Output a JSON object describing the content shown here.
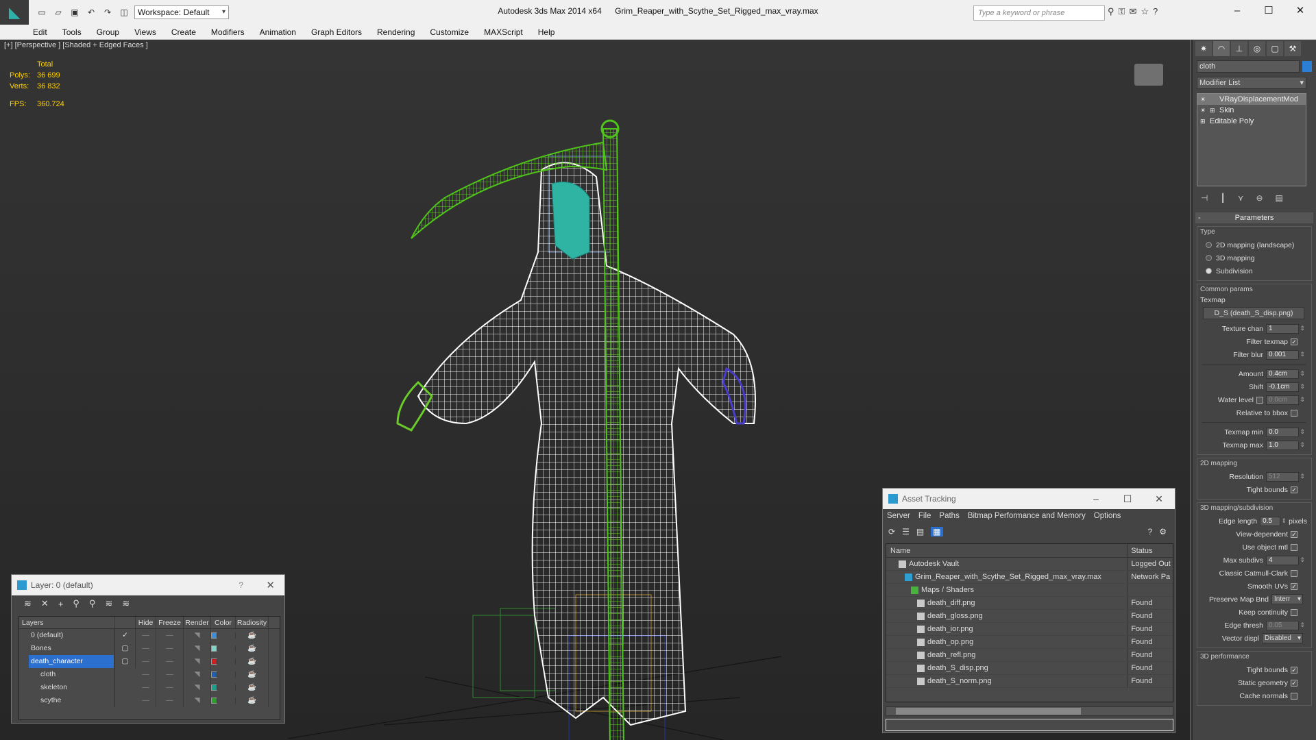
{
  "app": {
    "title": "Autodesk 3ds Max  2014 x64",
    "file": "Grim_Reaper_with_Scythe_Set_Rigged_max_vray.max",
    "workspace": "Workspace: Default",
    "search_placeholder": "Type a keyword or phrase"
  },
  "menu": [
    "Edit",
    "Tools",
    "Group",
    "Views",
    "Create",
    "Modifiers",
    "Animation",
    "Graph Editors",
    "Rendering",
    "Customize",
    "MAXScript",
    "Help"
  ],
  "viewport": {
    "label": "[+] [Perspective ] [Shaded + Edged Faces ]",
    "stats": {
      "total_label": "Total",
      "polys_label": "Polys:",
      "polys": "36 699",
      "verts_label": "Verts:",
      "verts": "36 832",
      "fps_label": "FPS:",
      "fps": "360.724"
    }
  },
  "command_panel": {
    "object_name": "cloth",
    "modifier_list": "Modifier List",
    "stack": [
      "VRayDisplacementMod",
      "Skin",
      "Editable Poly"
    ],
    "rollout": "Parameters",
    "type_group": "Type",
    "type_options": [
      "2D mapping (landscape)",
      "3D mapping",
      "Subdivision"
    ],
    "common_params": "Common params",
    "texmap_label": "Texmap",
    "texmap_value": "D_S (death_S_disp.png)",
    "texture_chan_label": "Texture chan",
    "texture_chan": "1",
    "filter_texmap_label": "Filter texmap",
    "filter_blur_label": "Filter blur",
    "filter_blur": "0.001",
    "amount_label": "Amount",
    "amount": "0.4cm",
    "shift_label": "Shift",
    "shift": "-0.1cm",
    "water_level_label": "Water level",
    "water_level": "0.0cm",
    "relative_bbox_label": "Relative to bbox",
    "texmap_min_label": "Texmap min",
    "texmap_min": "0.0",
    "texmap_max_label": "Texmap max",
    "texmap_max": "1.0",
    "mapping2d_group": "2D mapping",
    "resolution_label": "Resolution",
    "resolution": "512",
    "tight_bounds_label": "Tight bounds",
    "mapping3d_group": "3D mapping/subdivision",
    "edge_length_label": "Edge length",
    "edge_length": "0.5",
    "pixels_label": "pixels",
    "view_dependent_label": "View-dependent",
    "use_object_mtl_label": "Use object mtl",
    "max_subdivs_label": "Max subdivs",
    "max_subdivs": "4",
    "classic_cc_label": "Classic Catmull-Clark",
    "smooth_uvs_label": "Smooth UVs",
    "preserve_map_label": "Preserve Map Bnd",
    "preserve_map": "Interr",
    "keep_continuity_label": "Keep continuity",
    "edge_thresh_label": "Edge thresh",
    "edge_thresh": "0.05",
    "vector_displ_label": "Vector displ",
    "vector_displ": "Disabled",
    "perf_group": "3D performance",
    "perf_tight_bounds_label": "Tight bounds",
    "static_geometry_label": "Static geometry",
    "cache_normals_label": "Cache normals"
  },
  "layer_window": {
    "title": "Layer: 0 (default)",
    "help": "?",
    "columns": [
      "Layers",
      "Hide",
      "Freeze",
      "Render",
      "Color",
      "Radiosity"
    ],
    "rows": [
      {
        "name": "0 (default)",
        "color": "#3c8fd8",
        "current": true
      },
      {
        "name": "Bones",
        "color": "#7fd6c8"
      },
      {
        "name": "death_character",
        "color": "#cc2020",
        "selected": true
      },
      {
        "name": "cloth",
        "color": "#1f5fb0"
      },
      {
        "name": "skeleton",
        "color": "#17a08a"
      },
      {
        "name": "scythe",
        "color": "#2aa02a"
      }
    ]
  },
  "asset_window": {
    "title": "Asset Tracking",
    "menu": [
      "Server",
      "File",
      "Paths",
      "Bitmap Performance and Memory",
      "Options"
    ],
    "columns": [
      "Name",
      "Status"
    ],
    "rows": [
      {
        "name": "Autodesk Vault",
        "status": "Logged Out"
      },
      {
        "name": "Grim_Reaper_with_Scythe_Set_Rigged_max_vray.max",
        "status": "Network Pa"
      },
      {
        "name": "Maps / Shaders",
        "status": ""
      },
      {
        "name": "death_diff.png",
        "status": "Found"
      },
      {
        "name": "death_gloss.png",
        "status": "Found"
      },
      {
        "name": "death_ior.png",
        "status": "Found"
      },
      {
        "name": "death_op.png",
        "status": "Found"
      },
      {
        "name": "death_refl.png",
        "status": "Found"
      },
      {
        "name": "death_S_disp.png",
        "status": "Found"
      },
      {
        "name": "death_S_norm.png",
        "status": "Found"
      }
    ]
  },
  "colors": {
    "accent": "#2b6fcf",
    "stats": "#ffd200",
    "wire_green": "#4fc41a",
    "wire_white": "#ffffff"
  }
}
